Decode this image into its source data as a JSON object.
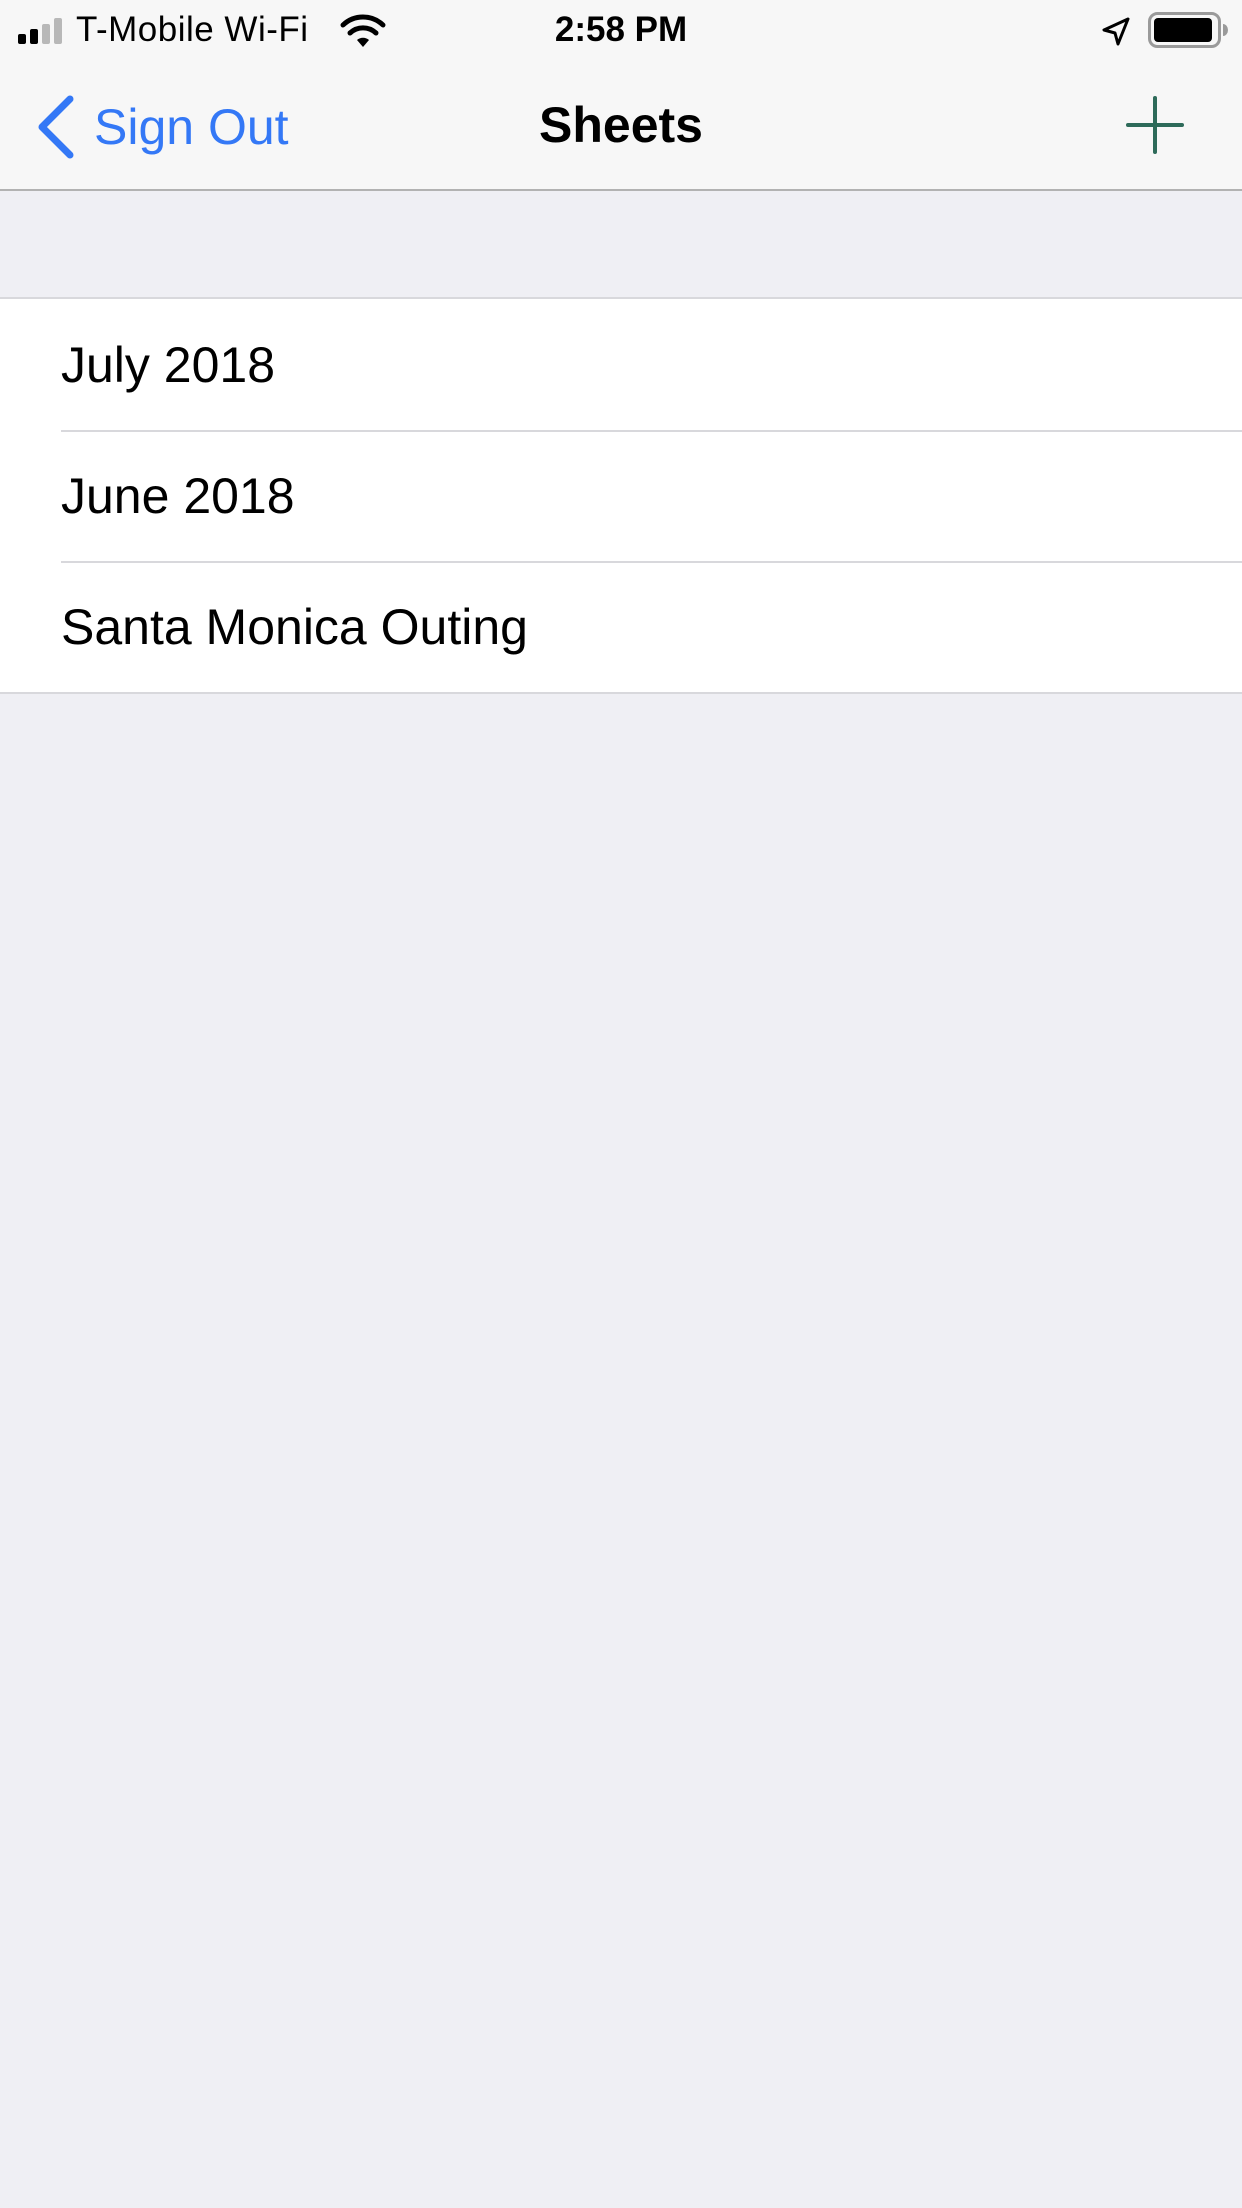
{
  "status_bar": {
    "carrier": "T-Mobile Wi-Fi",
    "time": "2:58 PM",
    "signal_bars_filled": 2,
    "signal_bars_total": 4,
    "battery_level": 0.9,
    "icons": [
      "signal-bars-icon",
      "wifi-icon",
      "location-arrow-icon",
      "battery-icon"
    ]
  },
  "nav": {
    "back_label": "Sign Out",
    "title": "Sheets",
    "back_icon": "chevron-left-icon",
    "add_icon": "plus-icon"
  },
  "sheets": [
    {
      "label": "July 2018"
    },
    {
      "label": "June 2018"
    },
    {
      "label": "Santa Monica Outing"
    }
  ],
  "colors": {
    "accent": "#3478f6",
    "add_button": "#2e6b5a",
    "background": "#efeff4",
    "bar_background": "#f7f7f7"
  }
}
